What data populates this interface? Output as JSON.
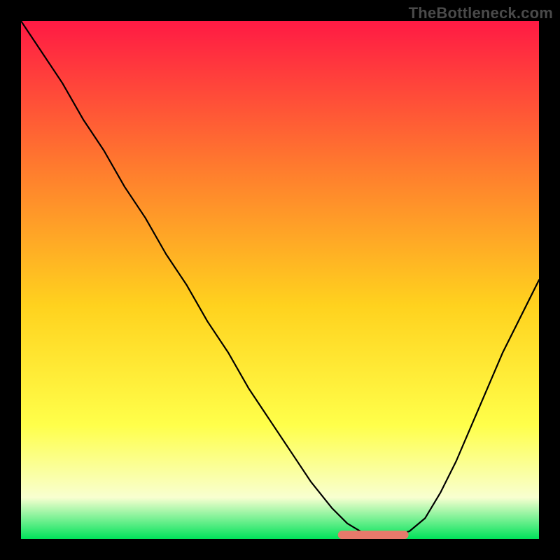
{
  "watermark": "TheBottleneck.com",
  "colors": {
    "frame_bg": "#000000",
    "gradient_top": "#ff1a44",
    "gradient_mid1": "#ff7a2e",
    "gradient_mid2": "#ffd21e",
    "gradient_mid3": "#ffff4a",
    "gradient_low": "#f8ffd0",
    "gradient_bottom": "#00e35a",
    "curve_stroke": "#000000",
    "cap_stroke": "#e8796b"
  },
  "chart_data": {
    "type": "line",
    "title": "",
    "xlabel": "",
    "ylabel": "",
    "xlim": [
      0,
      100
    ],
    "ylim": [
      0,
      100
    ],
    "series": [
      {
        "name": "bottleneck_curve",
        "x": [
          0,
          4,
          8,
          12,
          16,
          20,
          24,
          28,
          32,
          36,
          40,
          44,
          48,
          52,
          56,
          60,
          63,
          66,
          69,
          72,
          75,
          78,
          81,
          84,
          87,
          90,
          93,
          96,
          100
        ],
        "y": [
          100,
          94,
          88,
          81,
          75,
          68,
          62,
          55,
          49,
          42,
          36,
          29,
          23,
          17,
          11,
          6,
          3,
          1.2,
          0.6,
          0.7,
          1.5,
          4,
          9,
          15,
          22,
          29,
          36,
          42,
          50
        ]
      }
    ],
    "plateau": {
      "x_start": 62,
      "x_end": 74,
      "y": 0.8
    }
  }
}
